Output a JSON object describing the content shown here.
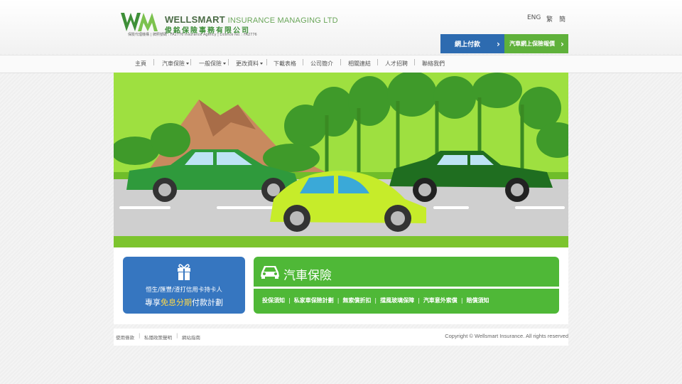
{
  "header": {
    "logo_en_bold": "WELLSMART",
    "logo_en_thin": "INSURANCE MANAGING LTD",
    "logo_zh": "俊銘保險事務有限公司",
    "logo_sub": "保險代理機構 | 牌照號碼 : FA2776    Insurance Agency | Licence No. : FA2776",
    "lang": [
      "ENG",
      "繁",
      "簡"
    ],
    "btn_pay": "網上付款",
    "btn_quote": "汽車網上保險報價"
  },
  "nav": {
    "items": [
      {
        "label": "主頁",
        "dropdown": false
      },
      {
        "label": "汽車保險",
        "dropdown": true
      },
      {
        "label": "一般保險",
        "dropdown": true
      },
      {
        "label": "更改資料",
        "dropdown": true
      },
      {
        "label": "下載表格",
        "dropdown": false
      },
      {
        "label": "公司簡介",
        "dropdown": false
      },
      {
        "label": "相關連結",
        "dropdown": false
      },
      {
        "label": "人才招聘",
        "dropdown": false
      },
      {
        "label": "聯絡我們",
        "dropdown": false
      }
    ]
  },
  "promo": {
    "icon": "gift-icon",
    "line1": "恒生/匯豐/渣打信用卡持卡人",
    "line2_a": "專享",
    "line2_hl": "免息分期",
    "line2_b": "付款計劃"
  },
  "car_insurance": {
    "icon": "car-icon",
    "title": "汽車保險",
    "links": [
      "投保須知",
      "私家車保險計劃",
      "無索償折扣",
      "擋風玻璃保障",
      "汽車意外索償",
      "賠償須知"
    ]
  },
  "footer": {
    "links": [
      "使用條款",
      "私隱政策聲明",
      "網站指南"
    ],
    "copyright": "Copyright © Wellsmart Insurance. All rights reserved"
  },
  "colors": {
    "blue": "#2d6bb0",
    "green": "#5fb13b",
    "promo_blue": "#3676c0",
    "card_green": "#4fb837"
  }
}
